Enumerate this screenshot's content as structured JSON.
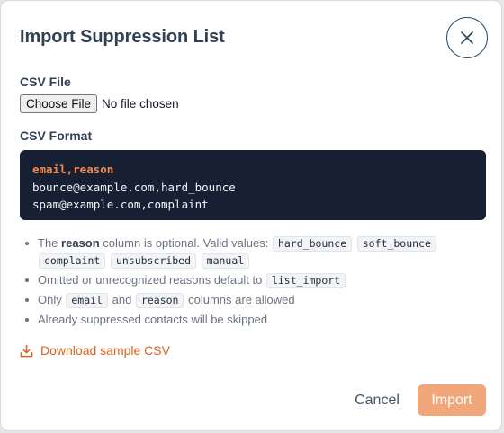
{
  "dialog": {
    "title": "Import Suppression List",
    "close_icon": "close-icon"
  },
  "file_field": {
    "label": "CSV File",
    "button_label": "Choose File",
    "status": "No file chosen"
  },
  "format": {
    "label": "CSV Format",
    "code_lines": [
      "email,reason",
      "bounce@example.com,hard_bounce",
      "spam@example.com,complaint"
    ]
  },
  "notes": {
    "item1": {
      "prefix": "The",
      "bold": "reason",
      "suffix": "column is optional. Valid values:",
      "values": [
        "hard_bounce",
        "soft_bounce",
        "complaint",
        "unsubscribed",
        "manual"
      ]
    },
    "item2": {
      "text": "Omitted or unrecognized reasons default to",
      "value": "list_import"
    },
    "item3": {
      "prefix": "Only",
      "code1": "email",
      "middle": "and",
      "code2": "reason",
      "suffix": "columns are allowed"
    },
    "item4": {
      "text": "Already suppressed contacts will be skipped"
    }
  },
  "download": {
    "label": "Download sample CSV",
    "icon": "download-icon"
  },
  "actions": {
    "cancel_label": "Cancel",
    "import_label": "Import"
  },
  "colors": {
    "accent": "#d9621f",
    "import_button": "#f2a77b",
    "code_background": "#172033",
    "code_header": "#f08a4b",
    "title_text": "#334155"
  }
}
